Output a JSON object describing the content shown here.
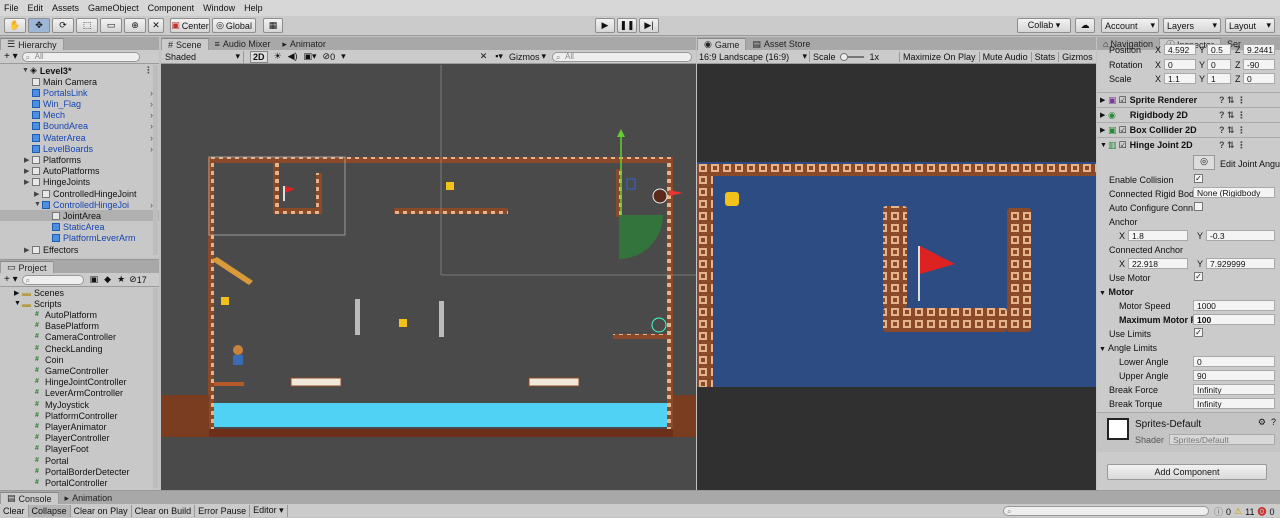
{
  "menu": [
    "File",
    "Edit",
    "Assets",
    "GameObject",
    "Component",
    "Window",
    "Help"
  ],
  "toolbar": {
    "center": "Center",
    "global": "Global",
    "collab": "Collab ▾",
    "account": "Account",
    "layers": "Layers",
    "layout": "Layout"
  },
  "hierarchy": {
    "tab": "Hierarchy",
    "search_placeholder": "All",
    "scene": "Level3*",
    "items": [
      {
        "label": "Main Camera",
        "indent": 1,
        "blue": false,
        "arrow": false
      },
      {
        "label": "PortalsLink",
        "indent": 1,
        "blue": true,
        "arrow": false
      },
      {
        "label": "Win_Flag",
        "indent": 1,
        "blue": true,
        "arrow": false
      },
      {
        "label": "Mech",
        "indent": 1,
        "blue": true,
        "arrow": false
      },
      {
        "label": "BoundArea",
        "indent": 1,
        "blue": true,
        "arrow": false
      },
      {
        "label": "WaterArea",
        "indent": 1,
        "blue": true,
        "arrow": false
      },
      {
        "label": "LevelBoards",
        "indent": 1,
        "blue": true,
        "arrow": false
      },
      {
        "label": "Platforms",
        "indent": 1,
        "blue": false,
        "arrow": true
      },
      {
        "label": "AutoPlatforms",
        "indent": 1,
        "blue": false,
        "arrow": true
      },
      {
        "label": "HingeJoints",
        "indent": 1,
        "blue": false,
        "arrow": true
      },
      {
        "label": "ControlledHingeJoint",
        "indent": 2,
        "blue": false,
        "arrow": true
      },
      {
        "label": "ControlledHingeJoi",
        "indent": 2,
        "blue": true,
        "arrow": true
      },
      {
        "label": "JointArea",
        "indent": 3,
        "blue": false,
        "arrow": false
      },
      {
        "label": "StaticArea",
        "indent": 3,
        "blue": true,
        "arrow": false
      },
      {
        "label": "PlatformLeverArm",
        "indent": 3,
        "blue": true,
        "arrow": false
      },
      {
        "label": "Effectors",
        "indent": 1,
        "blue": false,
        "arrow": true
      }
    ]
  },
  "project": {
    "tab": "Project",
    "count": "17",
    "folders": [
      "Scenes",
      "Scripts"
    ],
    "scripts": [
      "AutoPlatform",
      "BasePlatform",
      "CameraController",
      "CheckLanding",
      "Coin",
      "GameController",
      "HingeJointController",
      "LeverArmController",
      "MyJoystick",
      "PlatformController",
      "PlayerAnimator",
      "PlayerController",
      "PlayerFoot",
      "Portal",
      "PortalBorderDetecter",
      "PortalController"
    ]
  },
  "scene": {
    "tabs": [
      "Scene",
      "Audio Mixer",
      "Animator"
    ],
    "shading": "Shaded",
    "mode2d": "2D",
    "hidden_count": "0",
    "gizmos": "Gizmos",
    "search_placeholder": "All"
  },
  "game": {
    "tabs": [
      "Game",
      "Asset Store"
    ],
    "aspect": "16:9 Landscape (16:9)",
    "scale_label": "Scale",
    "scale_value": "1x",
    "options": [
      "Maximize On Play",
      "Mute Audio",
      "Stats",
      "Gizmos"
    ]
  },
  "inspector": {
    "tabs": [
      "Navigation",
      "Inspector",
      "Ser"
    ],
    "position_label": "Position",
    "position": {
      "x": "4.592",
      "y": "0.5",
      "z": "9.2441"
    },
    "rotation_label": "Rotation",
    "rotation": {
      "x": "0",
      "y": "0",
      "z": "-90"
    },
    "scale_label": "Scale",
    "scale": {
      "x": "1.1",
      "y": "1",
      "z": "0"
    },
    "components": [
      "Sprite Renderer",
      "Rigidbody 2D",
      "Box Collider 2D",
      "Hinge Joint 2D"
    ],
    "edit_joint": "Edit Joint Angu",
    "enable_collision": "Enable Collision",
    "connected_rb_label": "Connected Rigid Bod",
    "connected_rb_value": "None (Rigidbody",
    "auto_configure": "Auto Configure Conne",
    "anchor_label": "Anchor",
    "anchor": {
      "x": "1.8",
      "y": "-0.3"
    },
    "connected_anchor_label": "Connected Anchor",
    "connected_anchor": {
      "x": "22.918",
      "y": "7.929999"
    },
    "use_motor": "Use Motor",
    "motor_label": "Motor",
    "motor_speed_label": "Motor Speed",
    "motor_speed": "1000",
    "max_motor_label": "Maximum Motor F",
    "max_motor": "100",
    "use_limits": "Use Limits",
    "angle_limits": "Angle Limits",
    "lower_angle_label": "Lower Angle",
    "lower_angle": "0",
    "upper_angle_label": "Upper Angle",
    "upper_angle": "90",
    "break_force_label": "Break Force",
    "break_force": "Infinity",
    "break_torque_label": "Break Torque",
    "break_torque": "Infinity",
    "material_name": "Sprites-Default",
    "shader_label": "Shader",
    "shader_value": "Sprites/Default",
    "add_component": "Add Component"
  },
  "console": {
    "tabs": [
      "Console",
      "Animation"
    ],
    "buttons": [
      "Clear",
      "Collapse",
      "Clear on Play",
      "Clear on Build",
      "Error Pause",
      "Editor ▾"
    ],
    "errors": "0",
    "warnings": "11",
    "logs": "0"
  }
}
